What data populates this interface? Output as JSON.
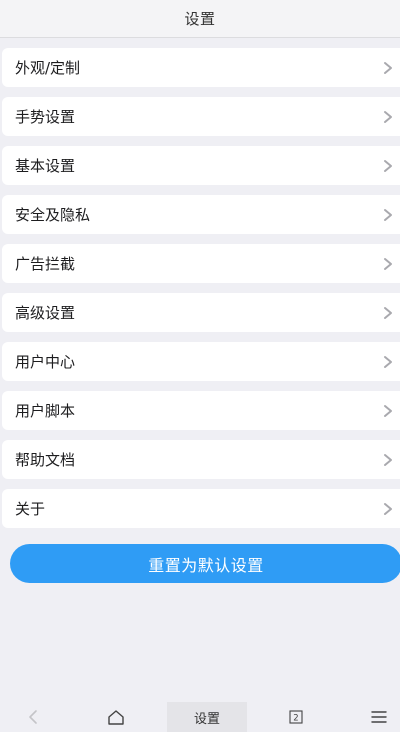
{
  "header": {
    "title": "设置"
  },
  "menu": {
    "items": [
      {
        "label": "外观/定制"
      },
      {
        "label": "手势设置"
      },
      {
        "label": "基本设置"
      },
      {
        "label": "安全及隐私"
      },
      {
        "label": "广告拦截"
      },
      {
        "label": "高级设置"
      },
      {
        "label": "用户中心"
      },
      {
        "label": "用户脚本"
      },
      {
        "label": "帮助文档"
      },
      {
        "label": "关于"
      }
    ],
    "chevron_icon": "chevron-right-icon"
  },
  "reset_button": {
    "label": "重置为默认设置"
  },
  "bottom_bar": {
    "back_icon": "back-arrow-icon",
    "home_icon": "home-icon",
    "current_tab_label": "设置",
    "tab_count": "2",
    "menu_icon": "hamburger-menu-icon"
  },
  "colors": {
    "accent": "#2f9cf5",
    "background": "#efeff4",
    "card": "#ffffff"
  }
}
